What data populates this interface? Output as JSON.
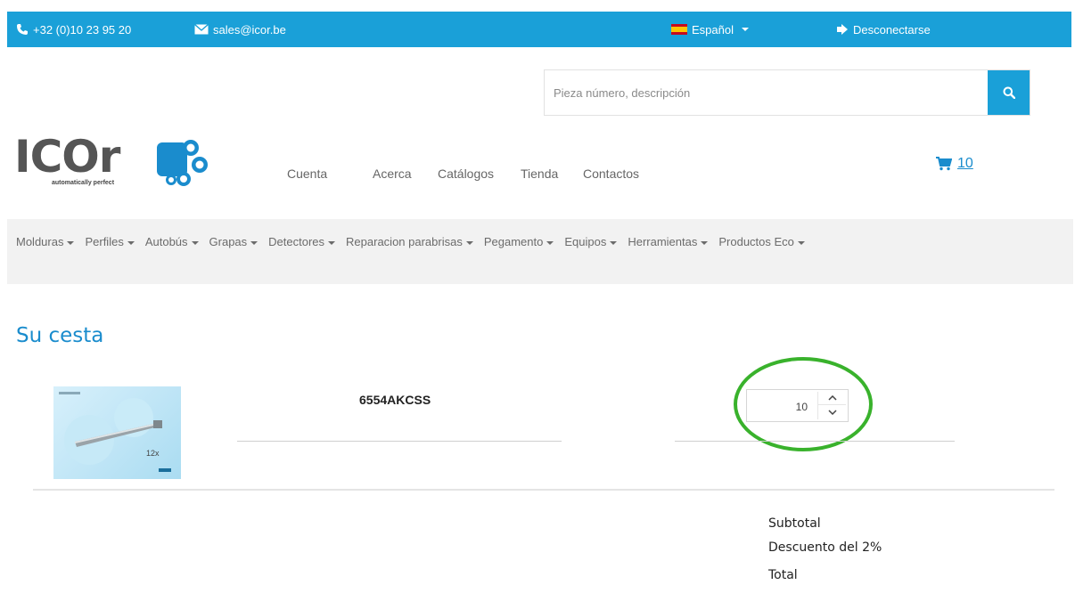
{
  "topbar": {
    "phone": "+32 (0)10 23 95 20",
    "email": "sales@icor.be",
    "language": "Español",
    "logout": "Desconectarse",
    "color": "#1aa0d8"
  },
  "search": {
    "placeholder": "Pieza número, descripción",
    "icon": "search-icon"
  },
  "logo": {
    "wordmark": "ICOr",
    "tagline": "automatically perfect"
  },
  "main_nav": [
    "Cuenta",
    "Acerca",
    "Catálogos",
    "Tienda",
    "Contactos"
  ],
  "cart": {
    "count": "10",
    "icon": "shopping-cart-icon"
  },
  "categories": [
    "Molduras",
    "Perfiles",
    "Autobús",
    "Grapas",
    "Detectores",
    "Reparacion parabrisas",
    "Pegamento",
    "Equipos",
    "Herramientas",
    "Productos Eco"
  ],
  "basket": {
    "heading": "Su cesta",
    "item": {
      "name": "6554AKCSS",
      "thumbnail_caption": "12x",
      "quantity": "10"
    }
  },
  "summary": {
    "subtotal": "Subtotal",
    "discount": "Descuento del 2%",
    "total": "Total"
  },
  "accent_color": "#1a8ccd",
  "highlight_color": "#39b22c"
}
